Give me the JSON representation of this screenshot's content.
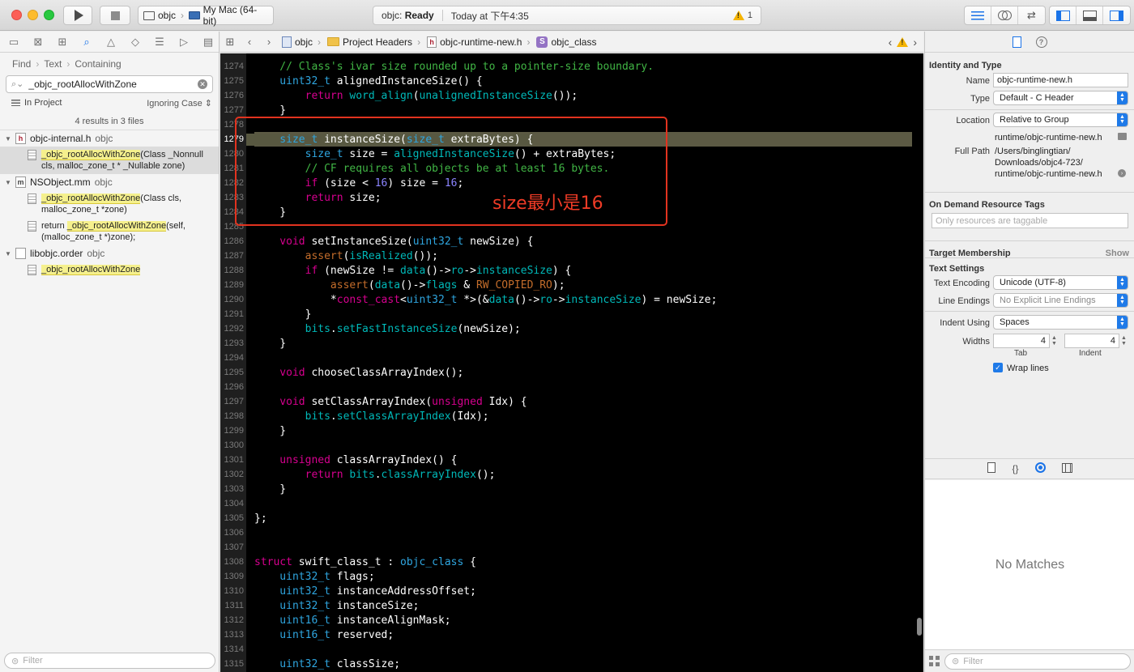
{
  "toolbar": {
    "scheme_project": "objc",
    "scheme_destination": "My Mac (64-bit)",
    "activity_project": "objc: ",
    "activity_status": "Ready",
    "activity_time": "Today at 下午4:35",
    "warning_count": "1"
  },
  "navigator": {
    "find_path": [
      "Find",
      "Text",
      "Containing"
    ],
    "search_value": "_objc_rootAllocWithZone",
    "scope_left": "In Project",
    "scope_right": "Ignoring Case",
    "results_count": "4 results in 3 files",
    "files": [
      {
        "name": "objc-internal.h",
        "project": "objc",
        "icon": "h",
        "matches": [
          {
            "before": "",
            "match": "_objc_rootAllocWithZone",
            "after": "(Class _Nonnull cls, malloc_zone_t * _Nullable zone)",
            "selected": true
          }
        ]
      },
      {
        "name": "NSObject.mm",
        "project": "objc",
        "icon": "m",
        "matches": [
          {
            "before": "",
            "match": "_objc_rootAllocWithZone",
            "after": "(Class cls, malloc_zone_t *zone)",
            "selected": false
          },
          {
            "before": "return ",
            "match": "_objc_rootAllocWithZone",
            "after": "(self, (malloc_zone_t *)zone);",
            "selected": false
          }
        ]
      },
      {
        "name": "libobjc.order",
        "project": "objc",
        "icon": "",
        "matches": [
          {
            "before": "",
            "match": "_objc_rootAllocWithZone",
            "after": "",
            "selected": false
          }
        ]
      }
    ],
    "filter_placeholder": "Filter"
  },
  "jumpbar": {
    "crumbs": [
      "objc",
      "Project Headers",
      "objc-runtime-new.h",
      "objc_class"
    ]
  },
  "editor": {
    "current_line": "1279",
    "lines": [
      {
        "n": "1274",
        "t": [
          [
            "cm",
            "    // Class's ivar size rounded up to a pointer-size boundary."
          ]
        ]
      },
      {
        "n": "1275",
        "t": [
          [
            "ty",
            "    uint32_t"
          ],
          [
            "pl",
            " alignedInstanceSize() {"
          ]
        ]
      },
      {
        "n": "1276",
        "t": [
          [
            "kw",
            "        return"
          ],
          [
            "pl",
            " "
          ],
          [
            "fn",
            "word_align"
          ],
          [
            "pl",
            "("
          ],
          [
            "fn",
            "unalignedInstanceSize"
          ],
          [
            "pl",
            "());"
          ]
        ]
      },
      {
        "n": "1277",
        "t": [
          [
            "pl",
            "    }"
          ]
        ]
      },
      {
        "n": "1278",
        "t": []
      },
      {
        "n": "1279",
        "t": [
          [
            "ty",
            "    size_t"
          ],
          [
            "pl",
            " instanceSize("
          ],
          [
            "ty",
            "size_t"
          ],
          [
            "pl",
            " extraBytes) {"
          ]
        ]
      },
      {
        "n": "1280",
        "t": [
          [
            "ty",
            "        size_t"
          ],
          [
            "pl",
            " size = "
          ],
          [
            "fn",
            "alignedInstanceSize"
          ],
          [
            "pl",
            "() + extraBytes;"
          ]
        ]
      },
      {
        "n": "1281",
        "t": [
          [
            "cm",
            "        // CF requires all objects be at least 16 bytes."
          ]
        ]
      },
      {
        "n": "1282",
        "t": [
          [
            "kw",
            "        if"
          ],
          [
            "pl",
            " (size < "
          ],
          [
            "nm",
            "16"
          ],
          [
            "pl",
            ") size = "
          ],
          [
            "nm",
            "16"
          ],
          [
            "pl",
            ";"
          ]
        ]
      },
      {
        "n": "1283",
        "t": [
          [
            "kw",
            "        return"
          ],
          [
            "pl",
            " size;"
          ]
        ]
      },
      {
        "n": "1284",
        "t": [
          [
            "pl",
            "    }"
          ]
        ]
      },
      {
        "n": "1285",
        "t": []
      },
      {
        "n": "1286",
        "t": [
          [
            "kw",
            "    void"
          ],
          [
            "pl",
            " setInstanceSize("
          ],
          [
            "ty",
            "uint32_t"
          ],
          [
            "pl",
            " newSize) {"
          ]
        ]
      },
      {
        "n": "1287",
        "t": [
          [
            "mc",
            "        assert"
          ],
          [
            "pl",
            "("
          ],
          [
            "fn",
            "isRealized"
          ],
          [
            "pl",
            "());"
          ]
        ]
      },
      {
        "n": "1288",
        "t": [
          [
            "kw",
            "        if"
          ],
          [
            "pl",
            " (newSize != "
          ],
          [
            "fn",
            "data"
          ],
          [
            "pl",
            "()->"
          ],
          [
            "fn",
            "ro"
          ],
          [
            "pl",
            "->"
          ],
          [
            "fn",
            "instanceSize"
          ],
          [
            "pl",
            ") {"
          ]
        ]
      },
      {
        "n": "1289",
        "t": [
          [
            "mc",
            "            assert"
          ],
          [
            "pl",
            "("
          ],
          [
            "fn",
            "data"
          ],
          [
            "pl",
            "()->"
          ],
          [
            "fn",
            "flags"
          ],
          [
            "pl",
            " & "
          ],
          [
            "mc",
            "RW_COPIED_RO"
          ],
          [
            "pl",
            ");"
          ]
        ]
      },
      {
        "n": "1290",
        "t": [
          [
            "pl",
            "            *"
          ],
          [
            "kw",
            "const_cast"
          ],
          [
            "pl",
            "<"
          ],
          [
            "ty",
            "uint32_t"
          ],
          [
            "pl",
            " *>(&"
          ],
          [
            "fn",
            "data"
          ],
          [
            "pl",
            "()->"
          ],
          [
            "fn",
            "ro"
          ],
          [
            "pl",
            "->"
          ],
          [
            "fn",
            "instanceSize"
          ],
          [
            "pl",
            ") = newSize;"
          ]
        ]
      },
      {
        "n": "1291",
        "t": [
          [
            "pl",
            "        }"
          ]
        ]
      },
      {
        "n": "1292",
        "t": [
          [
            "fn",
            "        bits"
          ],
          [
            "pl",
            "."
          ],
          [
            "fn",
            "setFastInstanceSize"
          ],
          [
            "pl",
            "(newSize);"
          ]
        ]
      },
      {
        "n": "1293",
        "t": [
          [
            "pl",
            "    }"
          ]
        ]
      },
      {
        "n": "1294",
        "t": []
      },
      {
        "n": "1295",
        "t": [
          [
            "kw",
            "    void"
          ],
          [
            "pl",
            " chooseClassArrayIndex();"
          ]
        ]
      },
      {
        "n": "1296",
        "t": []
      },
      {
        "n": "1297",
        "t": [
          [
            "kw",
            "    void"
          ],
          [
            "pl",
            " setClassArrayIndex("
          ],
          [
            "kw",
            "unsigned"
          ],
          [
            "pl",
            " Idx) {"
          ]
        ]
      },
      {
        "n": "1298",
        "t": [
          [
            "fn",
            "        bits"
          ],
          [
            "pl",
            "."
          ],
          [
            "fn",
            "setClassArrayIndex"
          ],
          [
            "pl",
            "(Idx);"
          ]
        ]
      },
      {
        "n": "1299",
        "t": [
          [
            "pl",
            "    }"
          ]
        ]
      },
      {
        "n": "1300",
        "t": []
      },
      {
        "n": "1301",
        "t": [
          [
            "kw",
            "    unsigned"
          ],
          [
            "pl",
            " classArrayIndex() {"
          ]
        ]
      },
      {
        "n": "1302",
        "t": [
          [
            "kw",
            "        return"
          ],
          [
            "pl",
            " "
          ],
          [
            "fn",
            "bits"
          ],
          [
            "pl",
            "."
          ],
          [
            "fn",
            "classArrayIndex"
          ],
          [
            "pl",
            "();"
          ]
        ]
      },
      {
        "n": "1303",
        "t": [
          [
            "pl",
            "    }"
          ]
        ]
      },
      {
        "n": "1304",
        "t": []
      },
      {
        "n": "1305",
        "t": [
          [
            "pl",
            "};"
          ]
        ]
      },
      {
        "n": "1306",
        "t": []
      },
      {
        "n": "1307",
        "t": []
      },
      {
        "n": "1308",
        "t": [
          [
            "kw",
            "struct"
          ],
          [
            "pl",
            " swift_class_t : "
          ],
          [
            "ty",
            "objc_class"
          ],
          [
            "pl",
            " {"
          ]
        ]
      },
      {
        "n": "1309",
        "t": [
          [
            "ty",
            "    uint32_t"
          ],
          [
            "pl",
            " flags;"
          ]
        ]
      },
      {
        "n": "1310",
        "t": [
          [
            "ty",
            "    uint32_t"
          ],
          [
            "pl",
            " instanceAddressOffset;"
          ]
        ]
      },
      {
        "n": "1311",
        "t": [
          [
            "ty",
            "    uint32_t"
          ],
          [
            "pl",
            " instanceSize;"
          ]
        ]
      },
      {
        "n": "1312",
        "t": [
          [
            "ty",
            "    uint16_t"
          ],
          [
            "pl",
            " instanceAlignMask;"
          ]
        ]
      },
      {
        "n": "1313",
        "t": [
          [
            "ty",
            "    uint16_t"
          ],
          [
            "pl",
            " reserved;"
          ]
        ]
      },
      {
        "n": "1314",
        "t": []
      },
      {
        "n": "1315",
        "t": [
          [
            "ty",
            "    uint32_t"
          ],
          [
            "pl",
            " classSize;"
          ]
        ]
      }
    ],
    "annotation": "size最小是16"
  },
  "inspector": {
    "identity_title": "Identity and Type",
    "name_label": "Name",
    "name_value": "objc-runtime-new.h",
    "type_label": "Type",
    "type_value": "Default - C Header",
    "location_label": "Location",
    "location_value": "Relative to Group",
    "location_path": "runtime/objc-runtime-new.h",
    "fullpath_label": "Full Path",
    "fullpath_lines": [
      "/Users/binglingtian/",
      "Downloads/objc4-723/",
      "runtime/objc-runtime-new.h"
    ],
    "tags_title": "On Demand Resource Tags",
    "tags_placeholder": "Only resources are taggable",
    "membership_title": "Target Membership",
    "membership_action": "Show",
    "text_settings_title": "Text Settings",
    "encoding_label": "Text Encoding",
    "encoding_value": "Unicode (UTF-8)",
    "endings_label": "Line Endings",
    "endings_value": "No Explicit Line Endings",
    "indent_label": "Indent Using",
    "indent_value": "Spaces",
    "widths_label": "Widths",
    "tab_value": "4",
    "tab_caption": "Tab",
    "indent_width_value": "4",
    "indent_caption": "Indent",
    "wrap_label": "Wrap lines",
    "no_matches": "No Matches",
    "filter_placeholder": "Filter"
  }
}
